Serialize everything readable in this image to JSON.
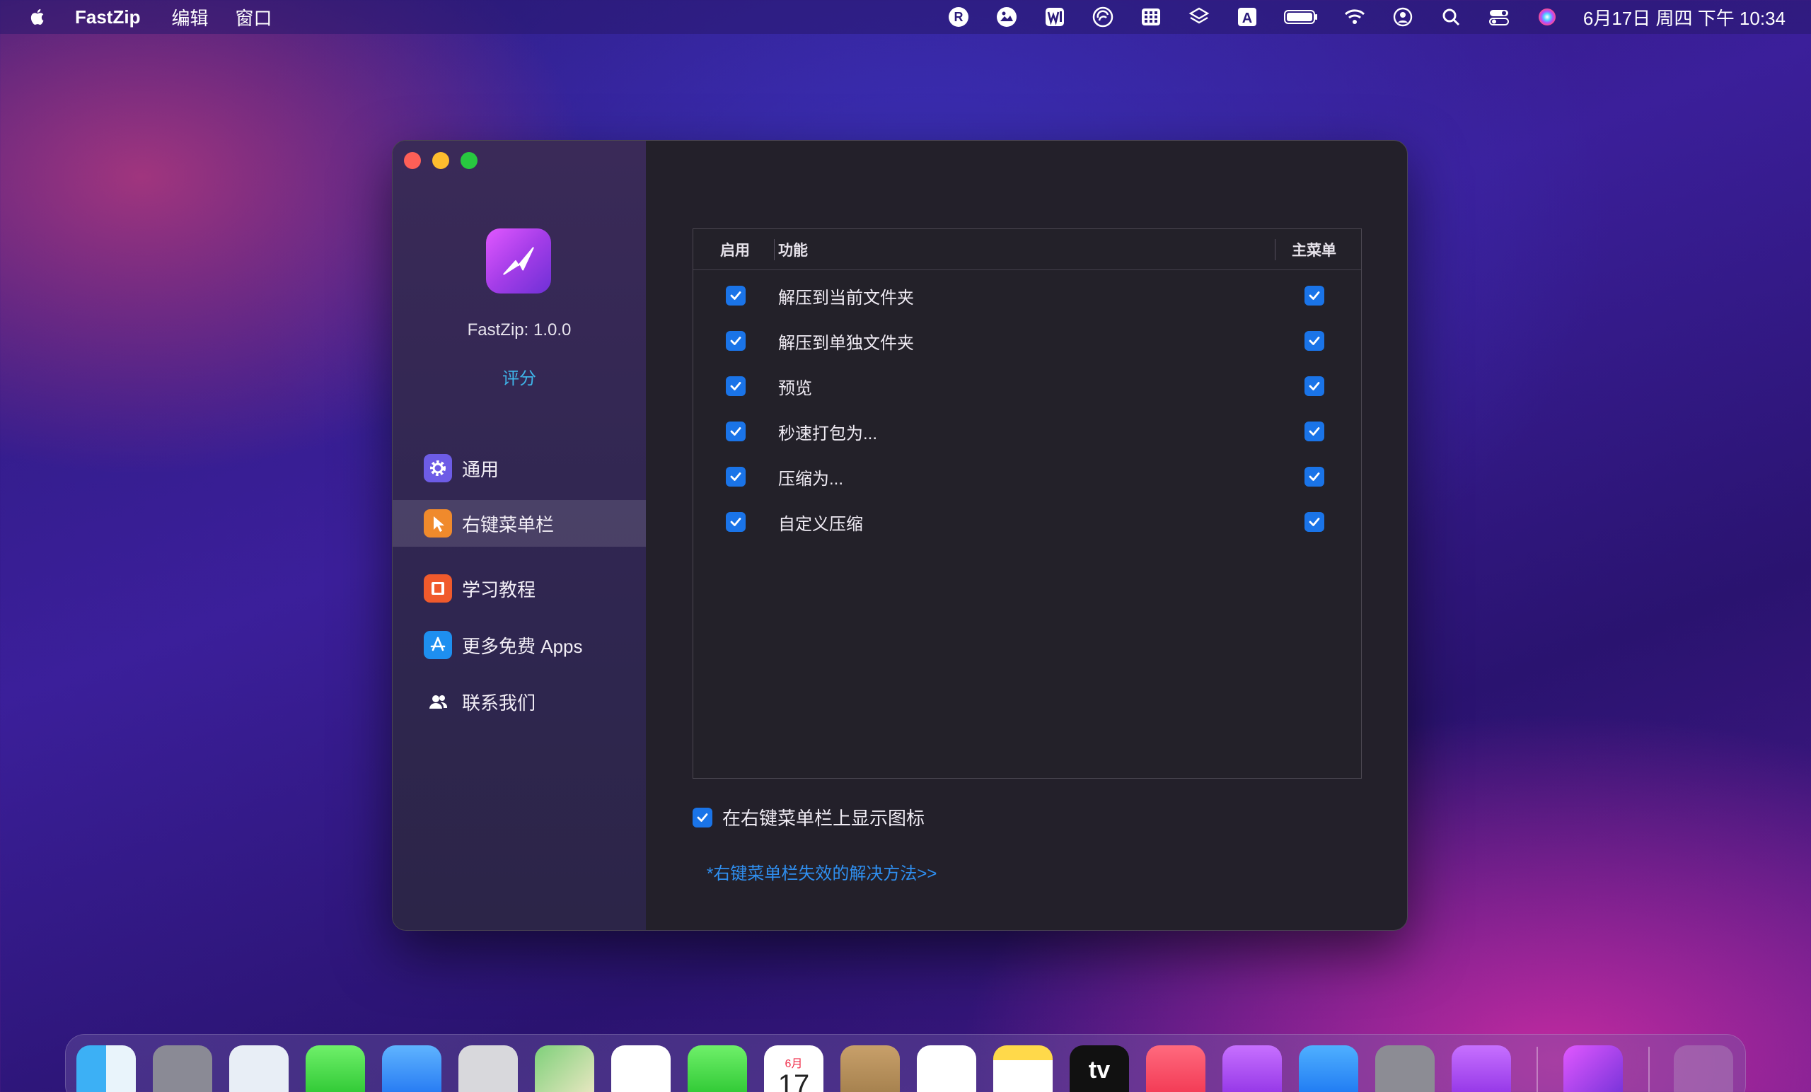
{
  "menubar": {
    "app_name": "FastZip",
    "menus": [
      "编辑",
      "窗口"
    ],
    "status_icons": [
      "r-icon",
      "photo-icon",
      "w-icon",
      "speed-icon",
      "grid-icon",
      "layers-icon",
      "a-icon",
      "battery-icon",
      "wifi-icon",
      "user-icon",
      "search-icon",
      "control-center-icon",
      "siri-icon"
    ],
    "clock": "6月17日 周四 下午 10:34"
  },
  "sidebar": {
    "app_version": "FastZip: 1.0.0",
    "rate_label": "评分",
    "items": [
      {
        "label": "通用",
        "icon": "gear-icon",
        "color": "#6d5ce6"
      },
      {
        "label": "右键菜单栏",
        "icon": "cursor-icon",
        "color": "#f08a2c",
        "selected": true
      },
      {
        "label": "学习教程",
        "icon": "book-icon",
        "color": "#f05a2c"
      },
      {
        "label": "更多免费 Apps",
        "icon": "app-store-icon",
        "color": "#1e8ff0"
      },
      {
        "label": "联系我们",
        "icon": "people-icon",
        "color": "none"
      }
    ]
  },
  "table": {
    "headers": {
      "enable": "启用",
      "function": "功能",
      "main_menu": "主菜单"
    },
    "rows": [
      {
        "label": "解压到当前文件夹",
        "enabled": true,
        "main_menu": true
      },
      {
        "label": "解压到单独文件夹",
        "enabled": true,
        "main_menu": true
      },
      {
        "label": "预览",
        "enabled": true,
        "main_menu": true
      },
      {
        "label": "秒速打包为...",
        "enabled": true,
        "main_menu": true
      },
      {
        "label": "压缩为...",
        "enabled": true,
        "main_menu": true
      },
      {
        "label": "自定义压缩",
        "enabled": true,
        "main_menu": true
      }
    ]
  },
  "options": {
    "show_icon_label": "在右键菜单栏上显示图标",
    "show_icon_checked": true,
    "fix_link": "*右键菜单栏失效的解决方法>>"
  },
  "dock": {
    "apps": [
      "finder",
      "launchpad",
      "safari",
      "messages",
      "mail",
      "screenshot",
      "maps",
      "photos",
      "facetime",
      "calendar",
      "contacts",
      "reminders",
      "notes",
      "tv",
      "music",
      "podcasts",
      "app-store",
      "system-preferences",
      "feedback",
      "fastzip",
      "trash"
    ],
    "calendar_month": "6月",
    "calendar_day": "17",
    "tv_label": "tv"
  },
  "colors": {
    "accent": "#1a74e8",
    "link": "#3fb4e8",
    "window_bg": "#23202a"
  }
}
